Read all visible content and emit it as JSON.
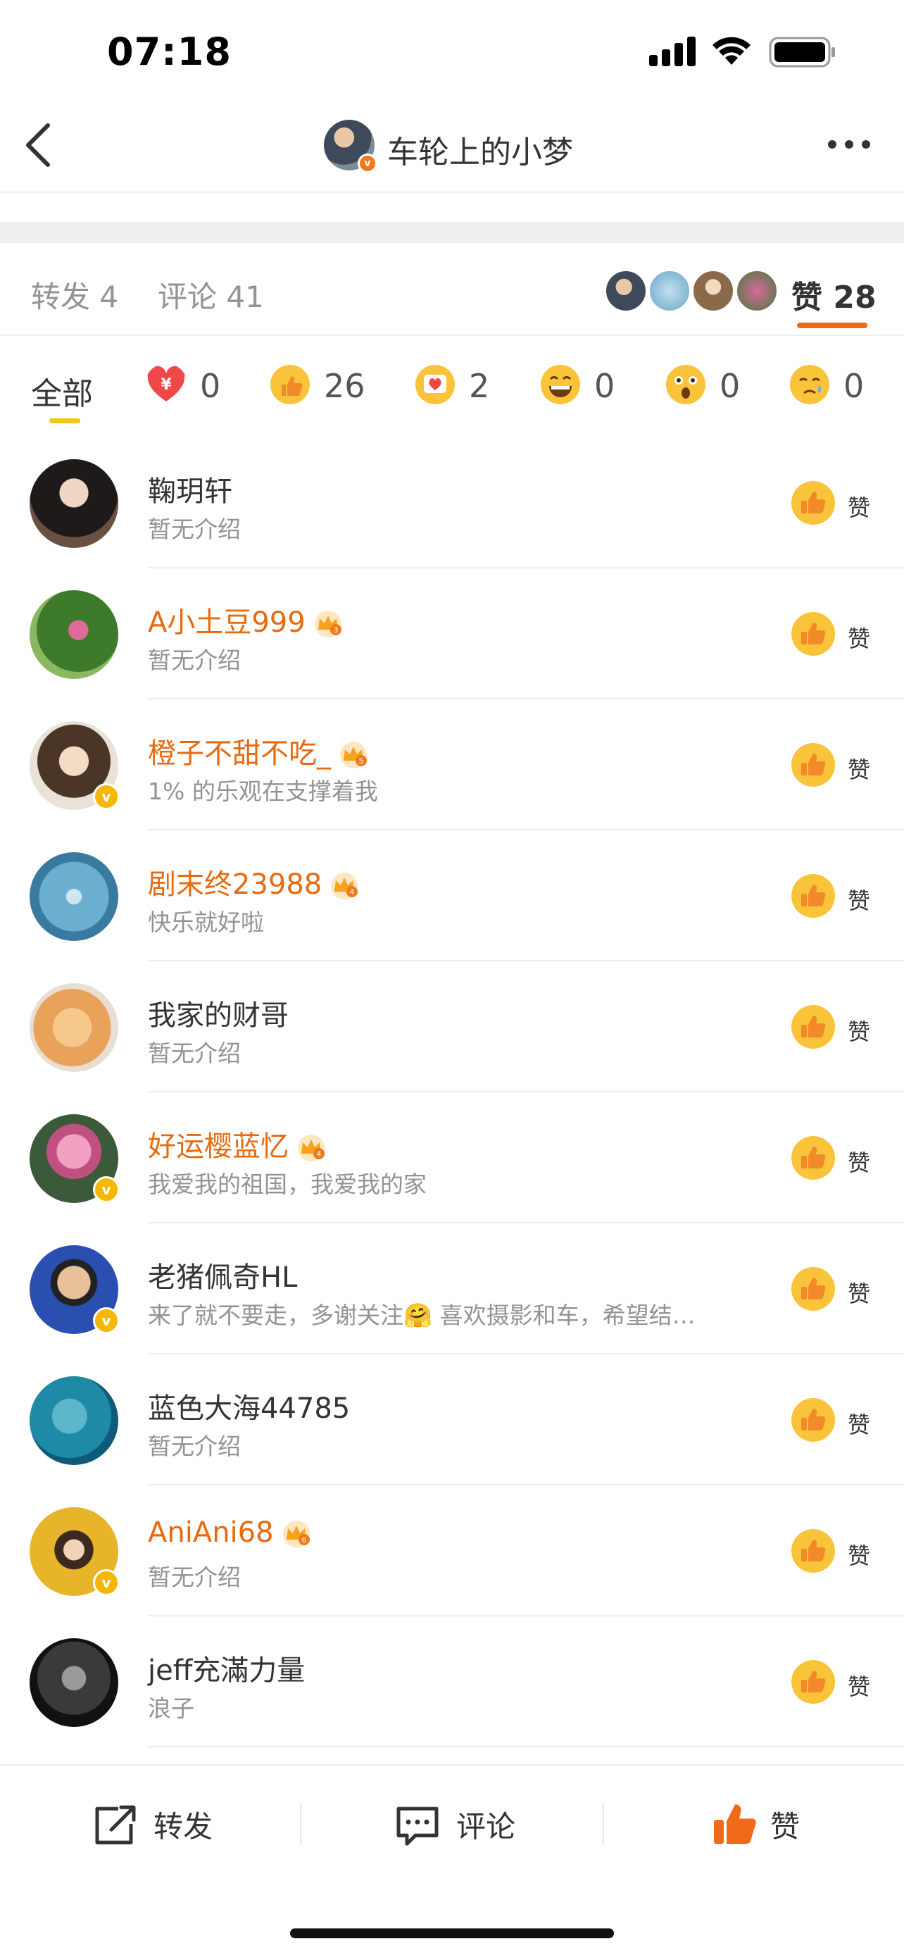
{
  "status_bar": {
    "time": "07:18"
  },
  "header": {
    "title": "车轮上的小梦",
    "verified": "v"
  },
  "tabs": {
    "repost": "转发 4",
    "comment": "评论 41",
    "likes_label": "赞",
    "likes_count": "28"
  },
  "filters": {
    "all_label": "全部",
    "reactions": [
      {
        "icon": "yuan-heart-icon",
        "count": "0",
        "color": "#f04848"
      },
      {
        "icon": "thumbs-up-emoji-icon",
        "count": "26",
        "color": "#f9c33a"
      },
      {
        "icon": "heart-card-emoji-icon",
        "count": "2",
        "color": "#f9c33a"
      },
      {
        "icon": "laughing-emoji-icon",
        "count": "0",
        "color": "#f9c33a"
      },
      {
        "icon": "surprised-emoji-icon",
        "count": "0",
        "color": "#f9c33a"
      },
      {
        "icon": "crying-emoji-icon",
        "count": "0",
        "color": "#f9c33a"
      }
    ]
  },
  "like_label": "赞",
  "users": [
    {
      "name": "鞠玥轩",
      "bio": "暂无介绍",
      "vip": false,
      "verified": false,
      "crown": ""
    },
    {
      "name": "A小土豆999",
      "bio": "暂无介绍",
      "vip": true,
      "verified": false,
      "crown": "3"
    },
    {
      "name": "橙子不甜不吃_",
      "bio": "1% 的乐观在支撑着我",
      "vip": true,
      "verified": true,
      "crown": "5"
    },
    {
      "name": "剧末终23988",
      "bio": "快乐就好啦",
      "vip": true,
      "verified": false,
      "crown": "4"
    },
    {
      "name": "我家的财哥",
      "bio": "暂无介绍",
      "vip": false,
      "verified": false,
      "crown": ""
    },
    {
      "name": "好运樱蓝忆",
      "bio": "我爱我的祖国，我爱我的家",
      "vip": true,
      "verified": true,
      "crown": "4"
    },
    {
      "name": "老猪佩奇HL",
      "bio": "来了就不要走，多谢关注🤗 喜欢摄影和车，希望结…",
      "vip": false,
      "verified": true,
      "crown": ""
    },
    {
      "name": "蓝色大海44785",
      "bio": "暂无介绍",
      "vip": false,
      "verified": false,
      "crown": ""
    },
    {
      "name": "AniAni68",
      "bio": "暂无介绍",
      "vip": true,
      "verified": true,
      "crown": "6"
    },
    {
      "name": "jeff充滿力量",
      "bio": "浪子",
      "vip": false,
      "verified": false,
      "crown": ""
    }
  ],
  "bottom_bar": {
    "repost": "转发",
    "comment": "评论",
    "like": "赞"
  },
  "colors": {
    "accent": "#f06a1a",
    "vip_name": "#e86a0e",
    "like": "#f9c33a"
  }
}
